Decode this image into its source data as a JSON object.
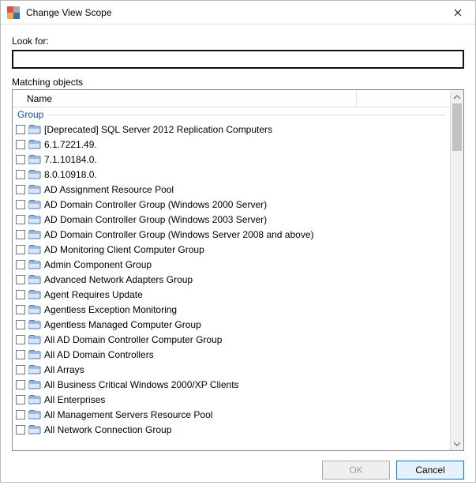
{
  "window": {
    "title": "Change View Scope"
  },
  "labels": {
    "look_for": "Look for:",
    "matching": "Matching objects",
    "name_col": "Name",
    "group_header": "Group"
  },
  "search": {
    "value": "",
    "placeholder": ""
  },
  "buttons": {
    "ok": "OK",
    "cancel": "Cancel"
  },
  "items": [
    {
      "label": "[Deprecated] SQL Server 2012 Replication Computers"
    },
    {
      "label": "6.1.7221.49."
    },
    {
      "label": "7.1.10184.0."
    },
    {
      "label": "8.0.10918.0."
    },
    {
      "label": "AD Assignment Resource Pool"
    },
    {
      "label": "AD Domain Controller Group (Windows 2000 Server)"
    },
    {
      "label": "AD Domain Controller Group (Windows 2003 Server)"
    },
    {
      "label": "AD Domain Controller Group (Windows Server 2008 and above)"
    },
    {
      "label": "AD Monitoring Client Computer Group"
    },
    {
      "label": "Admin Component Group"
    },
    {
      "label": "Advanced Network Adapters Group"
    },
    {
      "label": "Agent Requires Update"
    },
    {
      "label": "Agentless Exception Monitoring"
    },
    {
      "label": "Agentless Managed Computer Group"
    },
    {
      "label": "All AD Domain Controller Computer Group"
    },
    {
      "label": "All AD Domain Controllers"
    },
    {
      "label": "All Arrays"
    },
    {
      "label": "All Business Critical Windows 2000/XP Clients"
    },
    {
      "label": "All Enterprises"
    },
    {
      "label": "All Management Servers Resource Pool"
    },
    {
      "label": "All Network Connection Group"
    }
  ]
}
